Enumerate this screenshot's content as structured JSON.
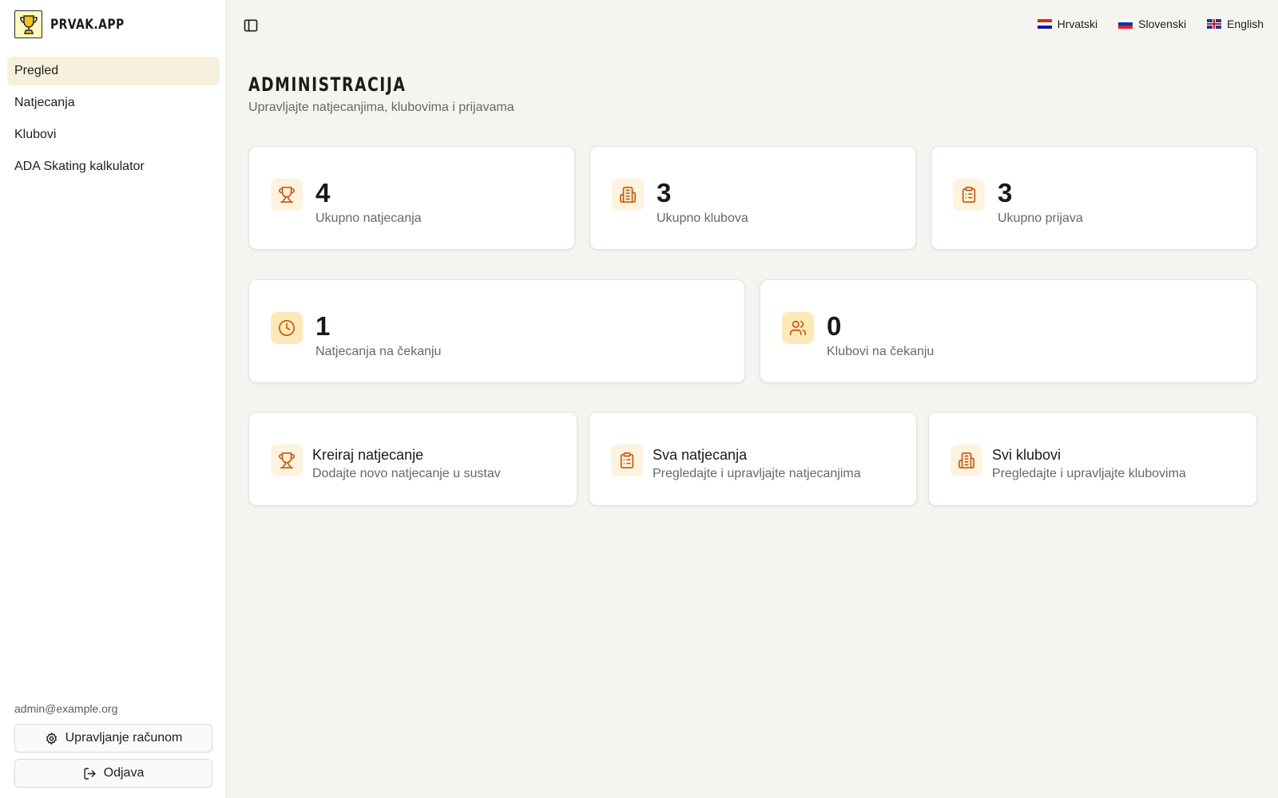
{
  "brand": {
    "name": "PRVAK.APP"
  },
  "sidebar": {
    "items": [
      {
        "label": "Pregled",
        "active": true
      },
      {
        "label": "Natjecanja",
        "active": false
      },
      {
        "label": "Klubovi",
        "active": false
      },
      {
        "label": "ADA Skating kalkulator",
        "active": false
      }
    ],
    "user_email": "admin@example.org",
    "account_label": "Upravljanje računom",
    "logout_label": "Odjava"
  },
  "languages": [
    {
      "label": "Hrvatski",
      "flag": "flag-croatia"
    },
    {
      "label": "Slovenski",
      "flag": "flag-slovenia"
    },
    {
      "label": "English",
      "flag": "flag-uk"
    }
  ],
  "header": {
    "title": "ADMINISTRACIJA",
    "subtitle": "Upravljajte natjecanjima, klubovima i prijavama"
  },
  "stats": [
    {
      "value": "4",
      "label": "Ukupno natjecanja",
      "icon": "trophy-icon"
    },
    {
      "value": "3",
      "label": "Ukupno klubova",
      "icon": "building-icon"
    },
    {
      "value": "3",
      "label": "Ukupno prijava",
      "icon": "clipboard-icon"
    },
    {
      "value": "1",
      "label": "Natjecanja na čekanju",
      "icon": "clock-icon"
    },
    {
      "value": "0",
      "label": "Klubovi na čekanju",
      "icon": "users-icon"
    }
  ],
  "actions": [
    {
      "title": "Kreiraj natjecanje",
      "desc": "Dodajte novo natjecanje u sustav",
      "icon": "trophy-icon"
    },
    {
      "title": "Sva natjecanja",
      "desc": "Pregledajte i upravljajte natjecanjima",
      "icon": "clipboard-icon"
    },
    {
      "title": "Svi klubovi",
      "desc": "Pregledajte i upravljajte klubovima",
      "icon": "building-icon"
    }
  ],
  "colors": {
    "accent": "#c2590c",
    "active_nav_bg": "#f6f0dd",
    "icon_bg": "#fdf3de",
    "page_bg": "#f5f4f1"
  }
}
